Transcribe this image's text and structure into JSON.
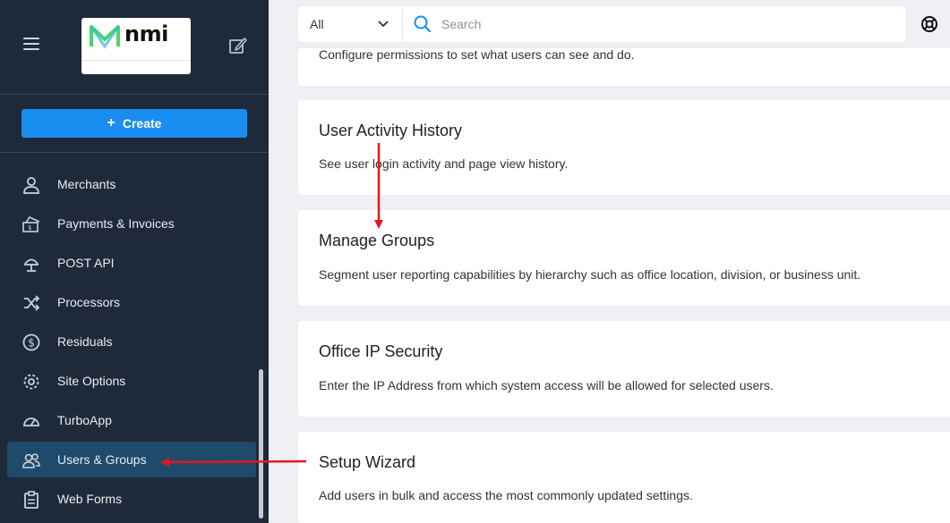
{
  "sidebar": {
    "logo_text": "nmi",
    "create_label": "Create",
    "items": [
      {
        "label": "Merchants",
        "icon": "user-icon"
      },
      {
        "label": "Payments & Invoices",
        "icon": "payments-icon"
      },
      {
        "label": "POST API",
        "icon": "api-icon"
      },
      {
        "label": "Processors",
        "icon": "shuffle-icon"
      },
      {
        "label": "Residuals",
        "icon": "dollar-circle-icon"
      },
      {
        "label": "Site Options",
        "icon": "gear-icon"
      },
      {
        "label": "TurboApp",
        "icon": "gauge-icon"
      },
      {
        "label": "Users & Groups",
        "icon": "users-icon",
        "active": true
      },
      {
        "label": "Web Forms",
        "icon": "clipboard-icon"
      }
    ]
  },
  "topbar": {
    "filter_value": "All",
    "search_placeholder": "Search"
  },
  "cards": [
    {
      "title": "",
      "desc": "Configure permissions to set what users can see and do."
    },
    {
      "title": "User Activity History",
      "desc": "See user login activity and page view history."
    },
    {
      "title": "Manage Groups",
      "desc": "Segment user reporting capabilities by hierarchy such as office location, division, or business unit."
    },
    {
      "title": "Office IP Security",
      "desc": "Enter the IP Address from which system access will be allowed for selected users."
    },
    {
      "title": "Setup Wizard",
      "desc": "Add users in bulk and access the most commonly updated settings."
    }
  ],
  "colors": {
    "sidebar_bg": "#1e2a3a",
    "accent": "#1a8df0",
    "active_item": "#1f4a6b",
    "annotation_arrow": "#e0191f",
    "logo_green": "#4fd36b"
  }
}
